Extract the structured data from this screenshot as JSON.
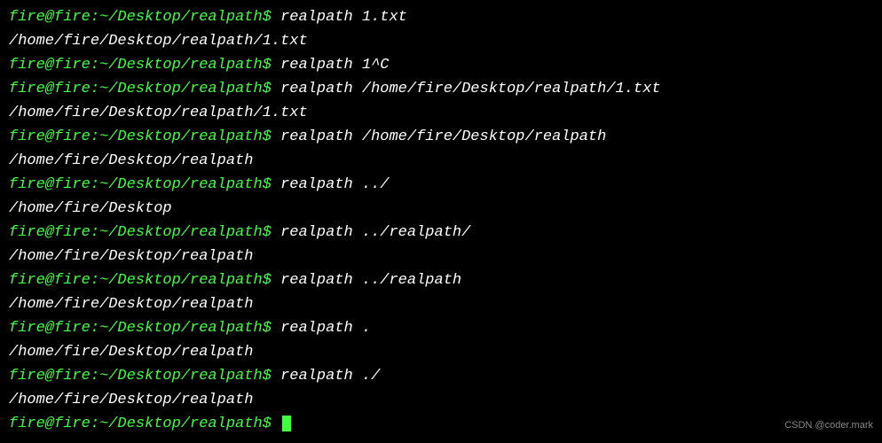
{
  "prompt": "fire@fire:~/Desktop/realpath$ ",
  "lines": [
    {
      "type": "cmd",
      "command": "realpath 1.txt"
    },
    {
      "type": "out",
      "text": "/home/fire/Desktop/realpath/1.txt"
    },
    {
      "type": "cmd",
      "command": "realpath 1^C"
    },
    {
      "type": "cmd",
      "command": "realpath /home/fire/Desktop/realpath/1.txt"
    },
    {
      "type": "out",
      "text": "/home/fire/Desktop/realpath/1.txt"
    },
    {
      "type": "cmd",
      "command": "realpath /home/fire/Desktop/realpath"
    },
    {
      "type": "out",
      "text": "/home/fire/Desktop/realpath"
    },
    {
      "type": "cmd",
      "command": "realpath ../"
    },
    {
      "type": "out",
      "text": "/home/fire/Desktop"
    },
    {
      "type": "cmd",
      "command": "realpath ../realpath/"
    },
    {
      "type": "out",
      "text": "/home/fire/Desktop/realpath"
    },
    {
      "type": "cmd",
      "command": "realpath ../realpath"
    },
    {
      "type": "out",
      "text": "/home/fire/Desktop/realpath"
    },
    {
      "type": "cmd",
      "command": "realpath ."
    },
    {
      "type": "out",
      "text": "/home/fire/Desktop/realpath"
    },
    {
      "type": "cmd",
      "command": "realpath ./"
    },
    {
      "type": "out",
      "text": "/home/fire/Desktop/realpath"
    },
    {
      "type": "cmd_cursor",
      "command": ""
    }
  ],
  "watermark": "CSDN @coder.mark"
}
